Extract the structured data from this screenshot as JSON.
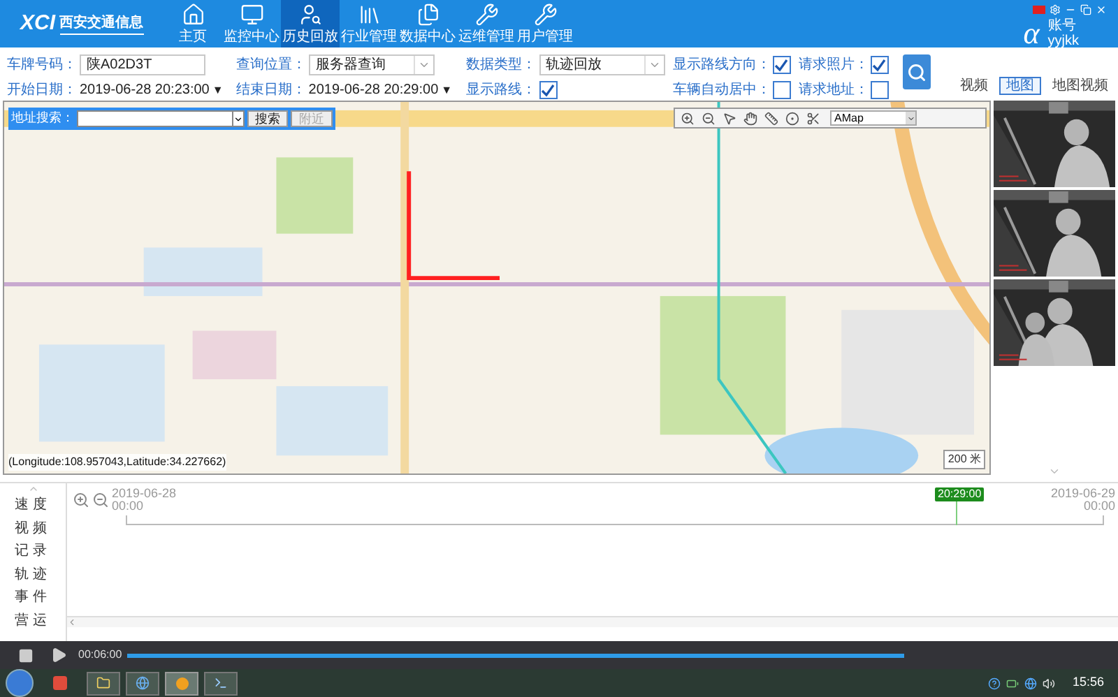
{
  "header": {
    "logo": {
      "mark": "XCI",
      "name": "西安交通信息"
    },
    "nav": [
      {
        "label": "主页",
        "selected": false
      },
      {
        "label": "监控中心",
        "selected": false
      },
      {
        "label": "历史回放",
        "selected": true
      },
      {
        "label": "行业管理",
        "selected": false
      },
      {
        "label": "数据中心",
        "selected": false
      },
      {
        "label": "运维管理",
        "selected": false
      },
      {
        "label": "用户管理",
        "selected": false
      }
    ],
    "account": {
      "logo": "α",
      "label": "账号",
      "user": "yyjkk"
    }
  },
  "query": {
    "plate": {
      "label": "车牌号码：",
      "value": "陕A02D3T"
    },
    "location": {
      "label": "查询位置：",
      "value": "服务器查询"
    },
    "data_type": {
      "label": "数据类型：",
      "value": "轨迹回放"
    },
    "start": {
      "label": "开始日期：",
      "value": "2019-06-28 20:23:00",
      "caret": "▼"
    },
    "end": {
      "label": "结束日期：",
      "value": "2019-06-28 20:29:00",
      "caret": "▼"
    },
    "show_route": {
      "label": "显示路线：",
      "checked": true
    },
    "options": [
      {
        "label": "显示路线方向：",
        "checked": true
      },
      {
        "label": "请求照片：",
        "checked": true
      },
      {
        "label": "车辆自动居中：",
        "checked": false
      },
      {
        "label": "请求地址：",
        "checked": false
      }
    ]
  },
  "view_tabs": [
    {
      "label": "视频",
      "selected": false
    },
    {
      "label": "地图",
      "selected": true
    },
    {
      "label": "地图视频",
      "selected": false
    }
  ],
  "map": {
    "search": {
      "label": "地址搜索：",
      "buttons": [
        {
          "label": "搜索",
          "disabled": false
        },
        {
          "label": "附近",
          "disabled": true
        }
      ]
    },
    "provider": "AMap",
    "coordinates": "(Longitude:108.957043,Latitude:34.227662)",
    "scale": "200 米"
  },
  "timeline": {
    "channels": [
      "速度",
      "视频",
      "记录",
      "轨迹",
      "事件",
      "营运"
    ],
    "start": [
      "2019-06-28",
      "00:00"
    ],
    "end": [
      "2019-06-29",
      "00:00"
    ],
    "marker": "20:29:00"
  },
  "player": {
    "time": "00:06:00",
    "level": 1
  },
  "taskbar": {
    "clock": "15:56"
  }
}
